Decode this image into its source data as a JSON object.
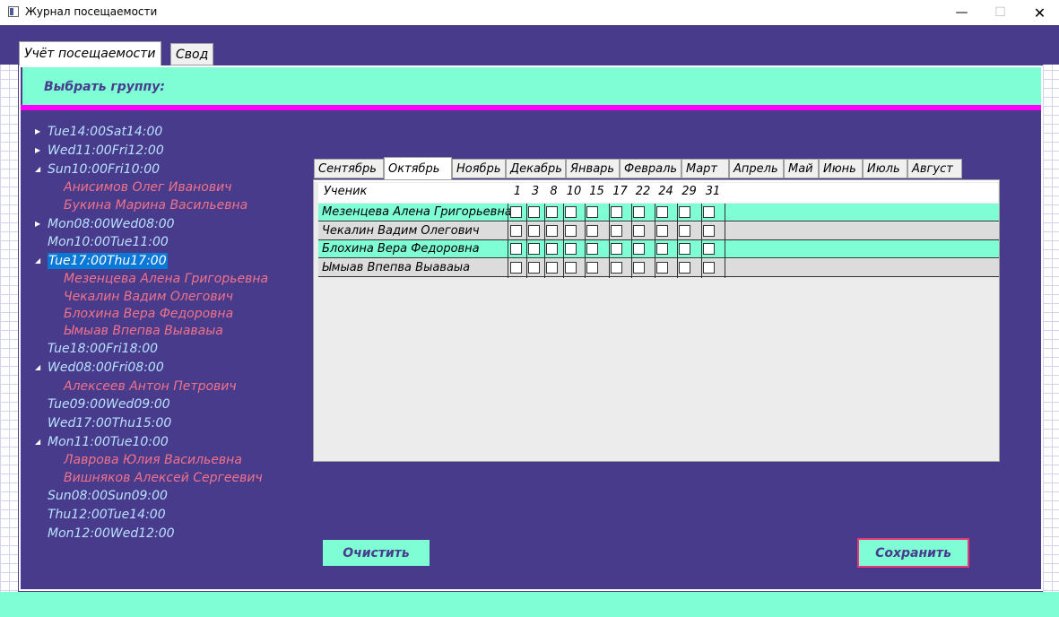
{
  "window": {
    "title": "Журнал посещаемости",
    "minimize_glyph": "—",
    "maximize_glyph": "☐",
    "close_glyph": "✕"
  },
  "main_tabs": [
    {
      "label": "Учёт посещаемости",
      "active": true
    },
    {
      "label": "Свод",
      "active": false
    }
  ],
  "group_header": {
    "label": "Выбрать группу:"
  },
  "tree": [
    {
      "label": "Tue14:00Sat14:00",
      "type": "group",
      "expander": "collapsed"
    },
    {
      "label": "Wed11:00Fri12:00",
      "type": "group",
      "expander": "collapsed"
    },
    {
      "label": "Sun10:00Fri10:00",
      "type": "group",
      "expander": "expanded"
    },
    {
      "label": "Анисимов Олег Иванович",
      "type": "student"
    },
    {
      "label": "Букина Марина Васильевна",
      "type": "student"
    },
    {
      "label": "Mon08:00Wed08:00",
      "type": "group",
      "expander": "collapsed"
    },
    {
      "label": "Mon10:00Tue11:00",
      "type": "group",
      "expander": "none"
    },
    {
      "label": "Tue17:00Thu17:00",
      "type": "group",
      "expander": "expanded",
      "selected": true
    },
    {
      "label": "Мезенцева Алена Григорьевна",
      "type": "student"
    },
    {
      "label": "Чекалин  Вадим Олегович",
      "type": "student"
    },
    {
      "label": "Блохина Вера Федоровна",
      "type": "student"
    },
    {
      "label": "Ымыав Впепва Выаваыа",
      "type": "student"
    },
    {
      "label": "Tue18:00Fri18:00",
      "type": "group",
      "expander": "none"
    },
    {
      "label": "Wed08:00Fri08:00",
      "type": "group",
      "expander": "expanded"
    },
    {
      "label": "Алексеев Антон Петрович",
      "type": "student"
    },
    {
      "label": "Tue09:00Wed09:00",
      "type": "group",
      "expander": "none"
    },
    {
      "label": "Wed17:00Thu15:00",
      "type": "group",
      "expander": "none"
    },
    {
      "label": "Mon11:00Tue10:00",
      "type": "group",
      "expander": "expanded"
    },
    {
      "label": "Лаврова Юлия Васильевна",
      "type": "student"
    },
    {
      "label": "Вишняков Алексей Сергеевич",
      "type": "student"
    },
    {
      "label": "Sun08:00Sun09:00",
      "type": "group",
      "expander": "none"
    },
    {
      "label": "Thu12:00Tue14:00",
      "type": "group",
      "expander": "none"
    },
    {
      "label": "Mon12:00Wed12:00",
      "type": "group",
      "expander": "none"
    }
  ],
  "month_tabs": [
    "Сентябрь",
    "Октябрь",
    "Ноябрь",
    "Декабрь",
    "Январь",
    "Февраль",
    "Март",
    "Апрель",
    "Май",
    "Июнь",
    "Июль",
    "Август"
  ],
  "active_month": "Октябрь",
  "attendance": {
    "student_header": "Ученик",
    "days": [
      "1",
      "3",
      "8",
      "10",
      "15",
      "17",
      "22",
      "24",
      "29",
      "31"
    ],
    "rows": [
      {
        "name": "Мезенцева Алена Григорьевна",
        "checked": [
          false,
          false,
          false,
          false,
          false,
          false,
          false,
          false,
          false,
          false
        ]
      },
      {
        "name": "Чекалин  Вадим Олегович",
        "checked": [
          false,
          false,
          false,
          false,
          false,
          false,
          false,
          false,
          false,
          false
        ]
      },
      {
        "name": "Блохина Вера Федоровна",
        "checked": [
          false,
          false,
          false,
          false,
          false,
          false,
          false,
          false,
          false,
          false
        ]
      },
      {
        "name": "Ымыав Впепва Выаваыа",
        "checked": [
          false,
          false,
          false,
          false,
          false,
          false,
          false,
          false,
          false,
          false
        ]
      }
    ]
  },
  "buttons": {
    "clear": "Очистить",
    "save": "Сохранить"
  },
  "colors": {
    "background": "#483b8c",
    "accent": "#7ffed6",
    "divider": "#ff00ff",
    "student_text": "#f07288",
    "group_text": "#b8e0ff",
    "selection": "#0a78d7",
    "save_border": "#e83878"
  }
}
